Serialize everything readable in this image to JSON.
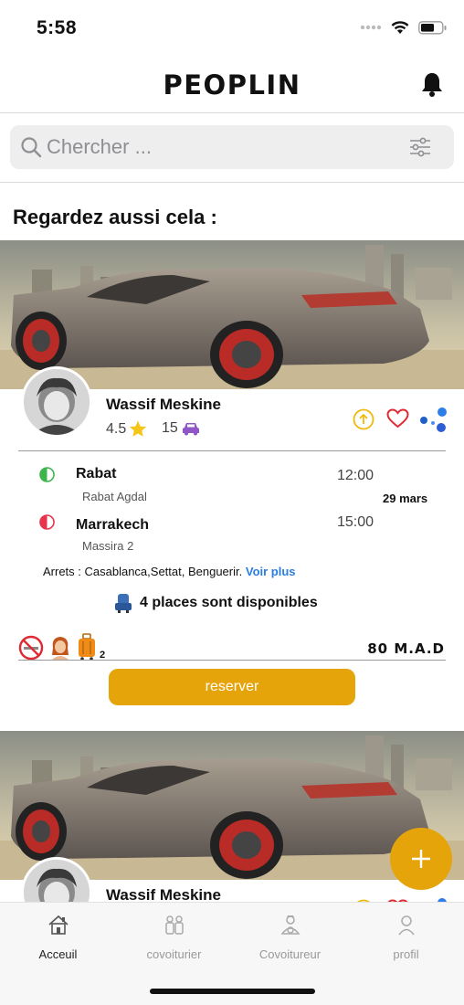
{
  "status_bar": {
    "time": "5:58"
  },
  "header": {
    "title": "PEOPLIN"
  },
  "search": {
    "placeholder": "Chercher ..."
  },
  "section": {
    "title": "Regardez aussi cela :"
  },
  "ride": {
    "driver": {
      "name": "Wassif Meskine",
      "rating": "4.5",
      "trips": "15"
    },
    "departure": {
      "city": "Rabat",
      "place": "Rabat Agdal",
      "time": "12:00"
    },
    "arrival": {
      "city": "Marrakech",
      "place": "Massira 2",
      "time": "15:00"
    },
    "date": "29 mars",
    "stops_label": "Arrets : Casablanca,Settat, Benguerir.",
    "see_more": "Voir plus",
    "seats_text": "4 places sont disponibles",
    "luggage_count": "2",
    "price": "80 M.A.D",
    "reserve_label": "reserver"
  },
  "ride2": {
    "driver_name": "Wassif Meskine"
  },
  "tabs": [
    {
      "label": "Acceuil",
      "icon": "house-icon",
      "active": true
    },
    {
      "label": "covoiturier",
      "icon": "passengers-icon",
      "active": false
    },
    {
      "label": "Covoitureur",
      "icon": "driver-icon",
      "active": false
    },
    {
      "label": "profil",
      "icon": "profile-icon",
      "active": false
    }
  ],
  "colors": {
    "accent": "#e6a40b",
    "link": "#2a7de1",
    "departure": "#3cb54a",
    "arrival": "#e8334a"
  }
}
